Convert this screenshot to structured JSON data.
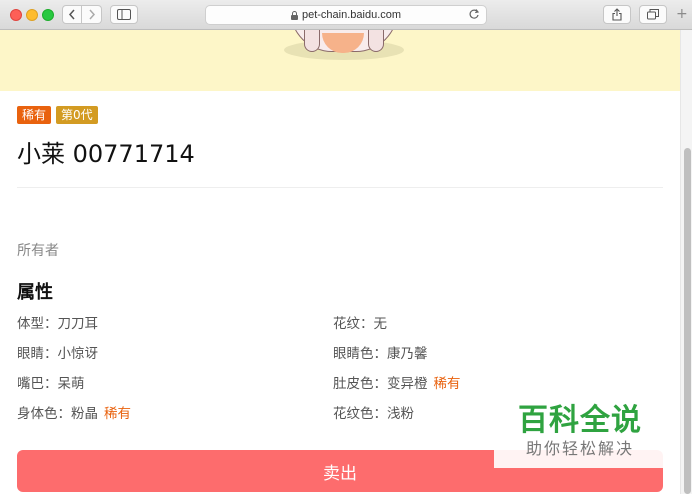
{
  "browser": {
    "url": "pet-chain.baidu.com",
    "new_tab_glyph": "+"
  },
  "pet": {
    "tags": [
      "稀有",
      "第0代"
    ],
    "name": "小莱 00771714",
    "owner_label": "所有者"
  },
  "attributes": {
    "heading": "属性",
    "items": [
      {
        "label": "体型",
        "value": "刀刀耳",
        "rare": ""
      },
      {
        "label": "花纹",
        "value": "无",
        "rare": ""
      },
      {
        "label": "眼睛",
        "value": "小惊讶",
        "rare": ""
      },
      {
        "label": "眼睛色",
        "value": "康乃馨",
        "rare": ""
      },
      {
        "label": "嘴巴",
        "value": "呆萌",
        "rare": ""
      },
      {
        "label": "肚皮色",
        "value": "变异橙",
        "rare": "稀有"
      },
      {
        "label": "身体色",
        "value": "粉晶",
        "rare": "稀有"
      },
      {
        "label": "花纹色",
        "value": "浅粉",
        "rare": ""
      }
    ],
    "separator": "："
  },
  "actions": {
    "sell_label": "卖出"
  },
  "watermark": {
    "main": "百科全说",
    "sub": "助你轻松解决"
  },
  "colors": {
    "hero_bg": "#fdf6c8",
    "rare_tag": "#e9620e",
    "generation_tag": "#d39b22",
    "sell_button": "#fd6c6d",
    "watermark_green": "#2fa340"
  },
  "icons": [
    "back-icon",
    "forward-icon",
    "sidebar-icon",
    "lock-icon",
    "reload-icon",
    "share-icon",
    "tabs-icon",
    "new-tab-icon"
  ]
}
